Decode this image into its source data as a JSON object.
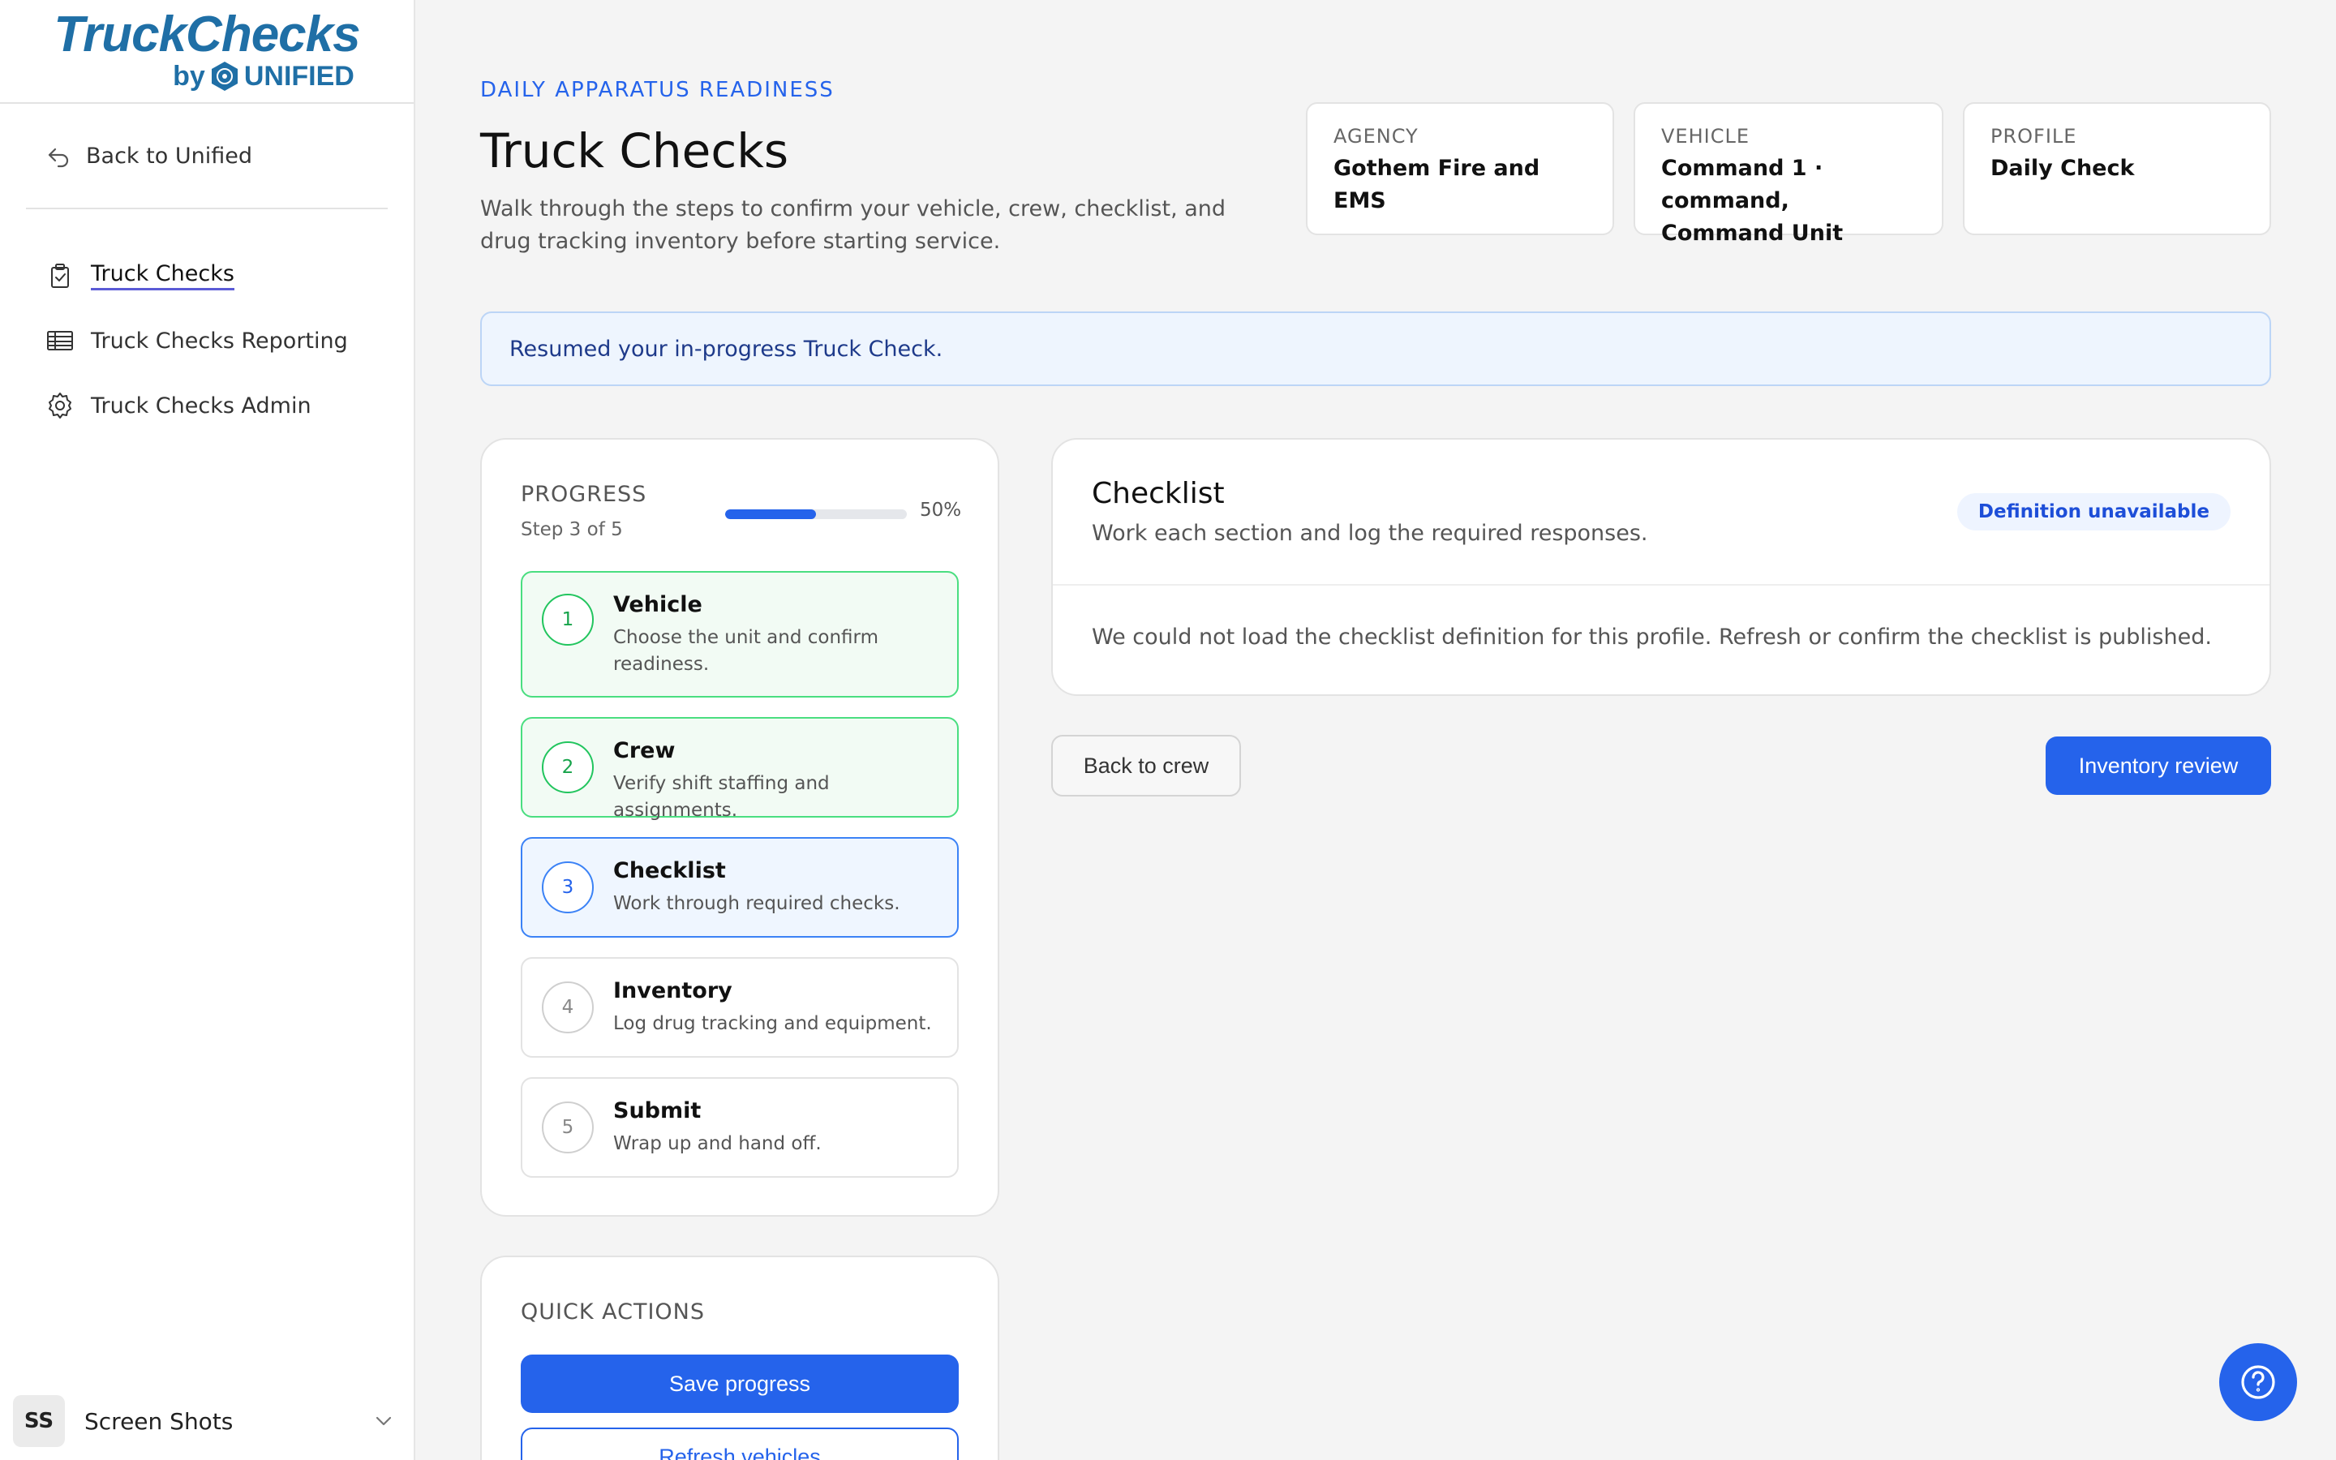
{
  "brand": {
    "name": "TruckChecks",
    "by": "by",
    "company": "UNIFIED"
  },
  "sidebar": {
    "back_label": "Back to Unified",
    "items": [
      {
        "label": "Truck Checks",
        "icon": "clipboard-check-icon",
        "active": true
      },
      {
        "label": "Truck Checks Reporting",
        "icon": "table-icon",
        "active": false
      },
      {
        "label": "Truck Checks Admin",
        "icon": "gear-icon",
        "active": false
      }
    ],
    "user": {
      "initials": "SS",
      "name": "Screen Shots"
    }
  },
  "header": {
    "eyebrow": "DAILY APPARATUS READINESS",
    "title": "Truck Checks",
    "description": "Walk through the steps to confirm your vehicle, crew, checklist, and drug tracking inventory before starting service."
  },
  "info_cards": [
    {
      "label": "AGENCY",
      "value": "Gothem Fire and EMS"
    },
    {
      "label": "VEHICLE",
      "value": "Command 1 · command, Command Unit"
    },
    {
      "label": "PROFILE",
      "value": "Daily Check"
    }
  ],
  "alert": {
    "message": "Resumed your in-progress Truck Check."
  },
  "progress": {
    "label": "PROGRESS",
    "step_text": "Step 3 of 5",
    "percent": 50,
    "percent_text": "50%",
    "steps": [
      {
        "number": "1",
        "title": "Vehicle",
        "description": "Choose the unit and confirm readiness.",
        "state": "done"
      },
      {
        "number": "2",
        "title": "Crew",
        "description": "Verify shift staffing and assignments.",
        "state": "done"
      },
      {
        "number": "3",
        "title": "Checklist",
        "description": "Work through required checks.",
        "state": "current"
      },
      {
        "number": "4",
        "title": "Inventory",
        "description": "Log drug tracking and equipment.",
        "state": "pending"
      },
      {
        "number": "5",
        "title": "Submit",
        "description": "Wrap up and hand off.",
        "state": "pending"
      }
    ]
  },
  "quick_actions": {
    "label": "QUICK ACTIONS",
    "save_label": "Save progress",
    "refresh_label": "Refresh vehicles"
  },
  "checklist": {
    "title": "Checklist",
    "subtitle": "Work each section and log the required responses.",
    "badge": "Definition unavailable",
    "message": "We could not load the checklist definition for this profile. Refresh or confirm the checklist is published."
  },
  "actions": {
    "back_label": "Back to crew",
    "next_label": "Inventory review"
  },
  "colors": {
    "accent": "#2563eb",
    "success": "#22c55e",
    "brand": "#1f6fa6"
  }
}
